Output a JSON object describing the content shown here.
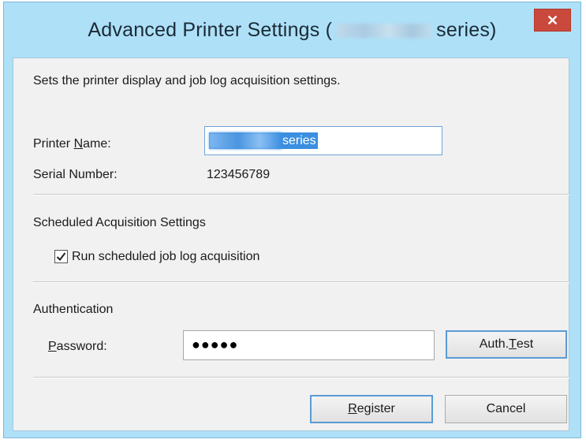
{
  "window": {
    "title_prefix": "Advanced Printer Settings (",
    "title_suffix": "series)",
    "close_glyph": "✕"
  },
  "dialog": {
    "description": "Sets the printer display and job log acquisition settings.",
    "printer_name": {
      "label_before": "Printer ",
      "label_access": "N",
      "label_after": "ame:",
      "value_visible": "series"
    },
    "serial_number": {
      "label": "Serial Number:",
      "value": "123456789"
    },
    "scheduled": {
      "heading": "Scheduled Acquisition Settings",
      "checkbox_before": "Run scheduled ",
      "checkbox_access": "j",
      "checkbox_after": "ob log acquisition",
      "checked": true
    },
    "authentication": {
      "heading": "Authentication",
      "password_access": "P",
      "password_after": "assword:",
      "password_masked": "●●●●●"
    },
    "buttons": {
      "auth_test_before": "Auth. ",
      "auth_test_access": "T",
      "auth_test_after": "est",
      "register_access": "R",
      "register_after": "egister",
      "cancel": "Cancel"
    }
  },
  "colors": {
    "frame": "#aee0f8",
    "close": "#c9493c",
    "selection": "#3b8fe0",
    "client_bg": "#f1f1f1"
  }
}
